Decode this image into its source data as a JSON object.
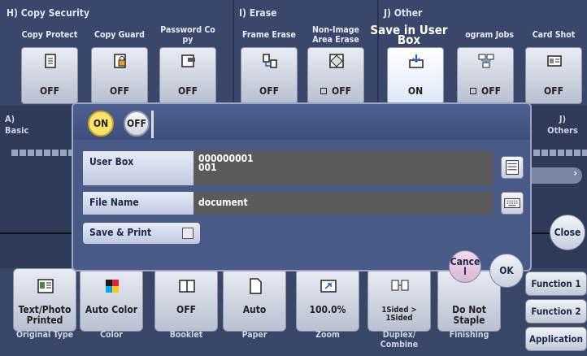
{
  "sections": {
    "copy_security": "H) Copy Security",
    "erase": "I) Erase",
    "other": "J) Other"
  },
  "top_functions": [
    {
      "label": "Copy Protect",
      "value": "OFF"
    },
    {
      "label": "Copy Guard",
      "value": "OFF"
    },
    {
      "label": "Password Co\npy",
      "value": "OFF"
    },
    {
      "label": "Frame Erase",
      "value": "OFF"
    },
    {
      "label": "Non-Image\nArea Erase",
      "value": "OFF"
    },
    {
      "label": "Save in User Box",
      "value": "ON"
    },
    {
      "label": "ogram Jobs",
      "value": "OFF"
    },
    {
      "label": "Card Shot",
      "value": "OFF"
    }
  ],
  "left_tab": {
    "line1": "A)",
    "line2": "Basic"
  },
  "right_tab": {
    "line1": "J)",
    "line2": "Others"
  },
  "dialog": {
    "on_label": "ON",
    "off_label": "OFF",
    "user_box_label": "User Box",
    "user_box_value_line1": "000000001",
    "user_box_value_line2": "001",
    "file_name_label": "File Name",
    "file_name_value": "document",
    "save_print_label": "Save & Print",
    "cancel_label": "Cance\nl",
    "ok_label": "OK"
  },
  "close_label": "Close",
  "bottom_functions": [
    {
      "value": "Text/Photo\nPrinted",
      "label": "Original Type"
    },
    {
      "value": "Auto Color",
      "label": "Color"
    },
    {
      "value": "OFF",
      "label": "Booklet"
    },
    {
      "value": "Auto",
      "label": "Paper"
    },
    {
      "value": "100.0%",
      "label": "Zoom"
    },
    {
      "value": "1Sided >\n1Sided",
      "label": "Duplex/\nCombine"
    },
    {
      "value": "Do Not\nStaple",
      "label": "Finishing"
    }
  ],
  "side_buttons": {
    "function1": "Function 1",
    "function2": "Function 2",
    "application": "Application"
  }
}
